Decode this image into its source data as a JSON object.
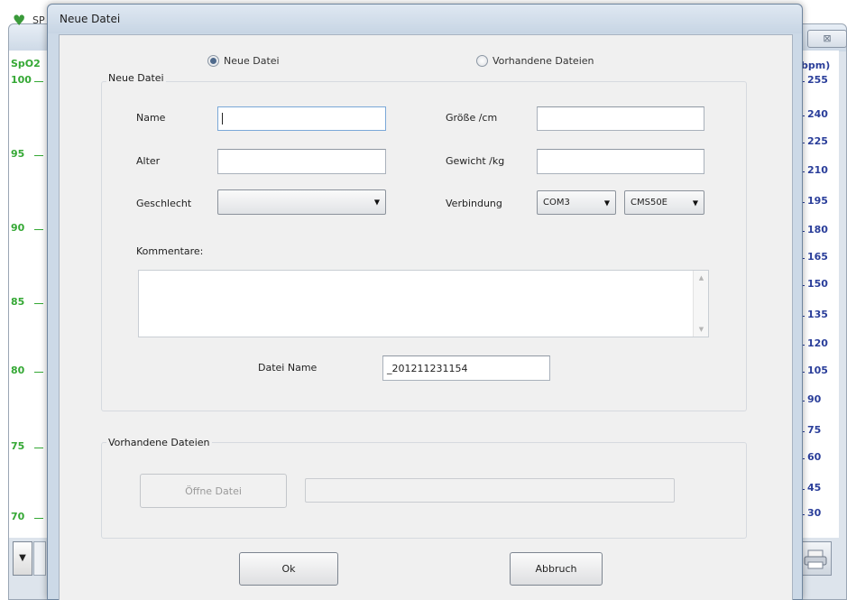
{
  "background_app": {
    "title": "SP",
    "left_axis": {
      "header": "SpO2",
      "ticks": [
        "100",
        "95",
        "90",
        "85",
        "80",
        "75",
        "70"
      ]
    },
    "right_axis": {
      "header": "bpm)",
      "ticks": [
        "255",
        "240",
        "225",
        "210",
        "195",
        "180",
        "165",
        "150",
        "135",
        "120",
        "105",
        "90",
        "75",
        "60",
        "45",
        "30"
      ]
    },
    "close_label": "⊠"
  },
  "dialog": {
    "title": "Neue Datei",
    "radio_new": {
      "label": "Neue Datei",
      "checked": true
    },
    "radio_existing": {
      "label": "Vorhandene Dateien",
      "checked": false
    },
    "new_group": {
      "title": "Neue Datei",
      "name_label": "Name",
      "name_value": "",
      "age_label": "Alter",
      "age_value": "",
      "gender_label": "Geschlecht",
      "gender_value": "",
      "height_label": "Größe /cm",
      "height_value": "",
      "weight_label": "Gewicht /kg",
      "weight_value": "",
      "connection_label": "Verbindung",
      "port_value": "COM3",
      "device_value": "CMS50E",
      "comments_label": "Kommentare:",
      "comments_value": "",
      "filename_label": "Datei Name",
      "filename_value": "_201211231154"
    },
    "existing_group": {
      "title": "Vorhandene Dateien",
      "open_button": "Öffne Datei",
      "path_value": ""
    },
    "ok_button": "Ok",
    "cancel_button": "Abbruch"
  }
}
